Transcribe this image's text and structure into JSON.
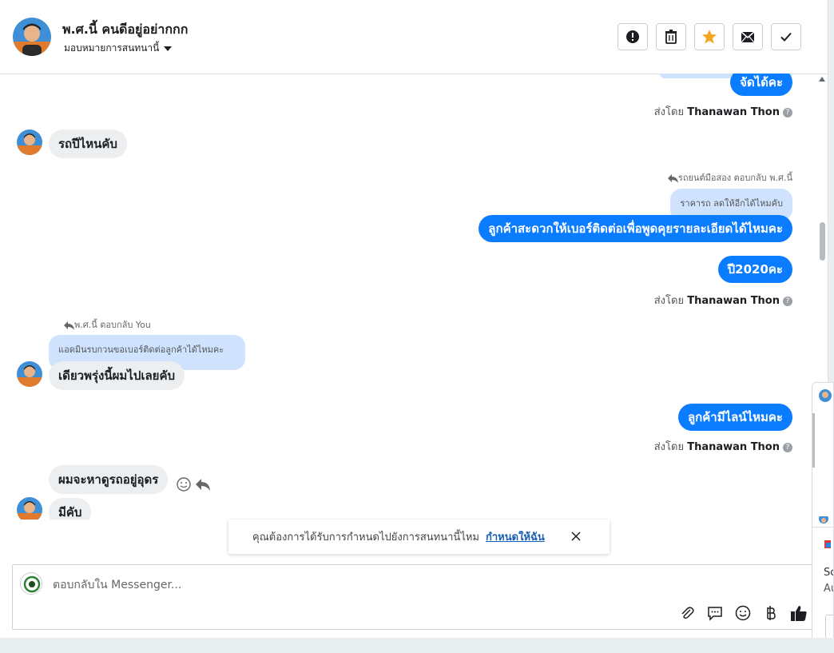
{
  "header": {
    "name": "พ.ศ.นี้ คนดีอยู่อย่ากกก",
    "assign_label": "มอบหมายการสนทนานี้",
    "buttons": [
      "spam-button",
      "delete-button",
      "star-button",
      "mark-unread-button",
      "done-button"
    ]
  },
  "messages": [
    {
      "id": "m1",
      "dir": "out",
      "text": "จัดได้คะ"
    },
    {
      "id": "m1s",
      "sent_prefix": "ส่งโดย",
      "sender": "Thanawan Thon"
    },
    {
      "id": "m2",
      "dir": "in",
      "text": "รถปีไหนคับ"
    },
    {
      "id": "m3r",
      "reply_note": "รถยนต์มือสอง ตอบกลับ พ.ศ.นี้"
    },
    {
      "id": "m3q",
      "quote": "ราคารถ ลดให้อีกได้ไหมคับ"
    },
    {
      "id": "m3",
      "dir": "out",
      "text": "ลูกค้าสะดวกให้เบอร์ติดต่อเพื่อพูดคุยรายละเอียดได้ไหมคะ"
    },
    {
      "id": "m4",
      "dir": "out",
      "text": "ปี2020คะ"
    },
    {
      "id": "m4s",
      "sent_prefix": "ส่งโดย",
      "sender": "Thanawan Thon"
    },
    {
      "id": "m5r",
      "reply_note": "พ.ศ.นี้ ตอบกลับ You"
    },
    {
      "id": "m5q",
      "quote": "แอดมินรบกวนขอเบอร์ติดต่อลูกค้าได้ไหมคะ"
    },
    {
      "id": "m5",
      "dir": "in",
      "text": "เดียวพรุ่งนี้ผมไปเลยคับ"
    },
    {
      "id": "m6",
      "dir": "out",
      "text": "ลูกค้ามีไลน์ไหมคะ"
    },
    {
      "id": "m6s",
      "sent_prefix": "ส่งโดย",
      "sender": "Thanawan Thon"
    },
    {
      "id": "m7",
      "dir": "in",
      "text": "ผมจะหาดูรถอยู่อุดร"
    },
    {
      "id": "m8",
      "dir": "in",
      "text": "มีคับ"
    }
  ],
  "toast": {
    "text": "คุณต้องการได้รับการกำหนดไปยังการสนทนานี้ไหม",
    "link": "กำหนดให้ฉัน"
  },
  "composer": {
    "placeholder": "ตอบกลับใน Messenger..."
  },
  "side_panel": {
    "line1": "Sc",
    "line2": "Au"
  },
  "colors": {
    "outgoing": "#0a7cff",
    "incoming": "#eceef0",
    "quote": "#cfe3ff",
    "star": "#f5a623"
  }
}
